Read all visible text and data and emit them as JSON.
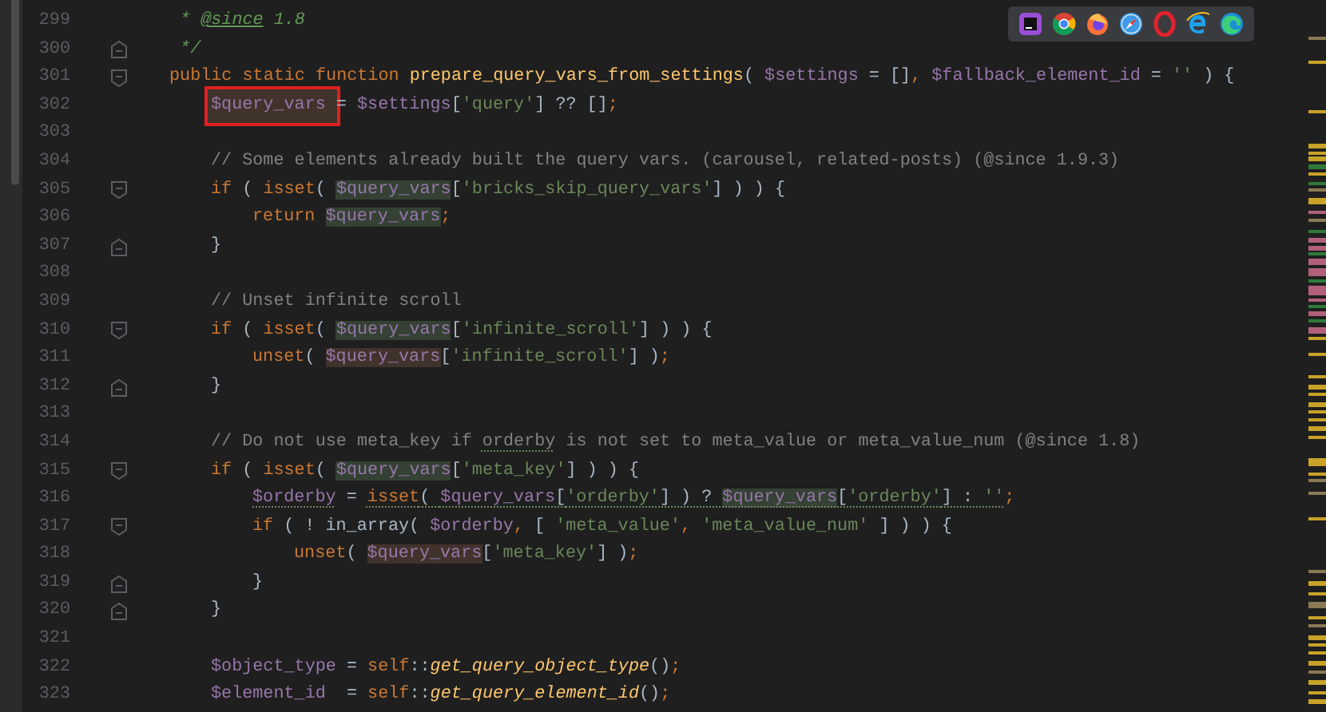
{
  "editor": {
    "lines": [
      {
        "number": "299",
        "tokens": [
          {
            "text": " * ",
            "kind": "doc"
          },
          {
            "text": "@since",
            "kind": "doctag"
          },
          {
            "text": " 1.8",
            "kind": "doc"
          }
        ]
      },
      {
        "number": "300",
        "fold_end": true,
        "tokens": [
          {
            "text": " */",
            "kind": "doc"
          }
        ]
      },
      {
        "number": "301",
        "fold_start": true,
        "tokens": [
          {
            "text": "public static function ",
            "kind": "kw"
          },
          {
            "text": "prepare_query_vars_from_settings",
            "kind": "fn"
          },
          {
            "text": "( ",
            "kind": "p"
          },
          {
            "text": "$settings",
            "kind": "var"
          },
          {
            "text": " = []",
            "kind": "p"
          },
          {
            "text": ", ",
            "kind": "kw"
          },
          {
            "text": "$fallback_element_id",
            "kind": "var"
          },
          {
            "text": " = ",
            "kind": "p"
          },
          {
            "text": "''",
            "kind": "str"
          },
          {
            "text": " ) {",
            "kind": "p"
          }
        ],
        "children": [
          {
            "number": "302",
            "tokens": [
              {
                "text": "$query_vars",
                "kind": "var",
                "write_highlight": true,
                "boxed": true
              },
              {
                "text": " = ",
                "kind": "p"
              },
              {
                "text": "$settings",
                "kind": "var"
              },
              {
                "text": "[",
                "kind": "p"
              },
              {
                "text": "'query'",
                "kind": "str"
              },
              {
                "text": "] ?? []",
                "kind": "p"
              },
              {
                "text": ";",
                "kind": "kw"
              }
            ]
          },
          {
            "number": "303"
          },
          {
            "number": "304",
            "tokens": [
              {
                "text": "// Some elements already built the query vars. (carousel, related-posts) (@since 1.9.3)",
                "kind": "cmt"
              }
            ]
          },
          {
            "number": "305",
            "fold_start": true,
            "tokens": [
              {
                "text": "if",
                "kind": "kw"
              },
              {
                "text": " ( ",
                "kind": "p"
              },
              {
                "text": "isset",
                "kind": "kw"
              },
              {
                "text": "( ",
                "kind": "p"
              },
              {
                "text": "$query_vars",
                "kind": "var",
                "read_highlight": true
              },
              {
                "text": "[",
                "kind": "p"
              },
              {
                "text": "'bricks_skip_query_vars'",
                "kind": "str"
              },
              {
                "text": "] ) ) {",
                "kind": "p"
              }
            ],
            "children": [
              {
                "number": "306",
                "tokens": [
                  {
                    "text": "return ",
                    "kind": "kw"
                  },
                  {
                    "text": "$query_vars",
                    "kind": "var",
                    "read_highlight": true
                  },
                  {
                    "text": ";",
                    "kind": "kw"
                  }
                ]
              }
            ]
          },
          {
            "number": "307",
            "fold_end": true,
            "tokens": [
              {
                "text": "}",
                "kind": "p"
              }
            ]
          },
          {
            "number": "308"
          },
          {
            "number": "309",
            "tokens": [
              {
                "text": "// Unset infinite scroll",
                "kind": "cmt"
              }
            ]
          },
          {
            "number": "310",
            "fold_start": true,
            "tokens": [
              {
                "text": "if",
                "kind": "kw"
              },
              {
                "text": " ( ",
                "kind": "p"
              },
              {
                "text": "isset",
                "kind": "kw"
              },
              {
                "text": "( ",
                "kind": "p"
              },
              {
                "text": "$query_vars",
                "kind": "var",
                "read_highlight": true
              },
              {
                "text": "[",
                "kind": "p"
              },
              {
                "text": "'infinite_scroll'",
                "kind": "str"
              },
              {
                "text": "] ) ) {",
                "kind": "p"
              }
            ],
            "children": [
              {
                "number": "311",
                "tokens": [
                  {
                    "text": "unset",
                    "kind": "kw"
                  },
                  {
                    "text": "( ",
                    "kind": "p"
                  },
                  {
                    "text": "$query_vars",
                    "kind": "var",
                    "write_highlight": true
                  },
                  {
                    "text": "[",
                    "kind": "p"
                  },
                  {
                    "text": "'infinite_scroll'",
                    "kind": "str"
                  },
                  {
                    "text": "] )",
                    "kind": "p"
                  },
                  {
                    "text": ";",
                    "kind": "kw"
                  }
                ]
              }
            ]
          },
          {
            "number": "312",
            "fold_end": true,
            "tokens": [
              {
                "text": "}",
                "kind": "p"
              }
            ]
          },
          {
            "number": "313"
          },
          {
            "number": "314",
            "tokens": [
              {
                "text": "// Do not use meta_key if ",
                "kind": "cmt"
              },
              {
                "text": "orderby",
                "kind": "cmt",
                "underline": true
              },
              {
                "text": " is not set to meta_value or meta_value_num (@since 1.8)",
                "kind": "cmt"
              }
            ]
          },
          {
            "number": "315",
            "fold_start": true,
            "tokens": [
              {
                "text": "if",
                "kind": "kw"
              },
              {
                "text": " ( ",
                "kind": "p"
              },
              {
                "text": "isset",
                "kind": "kw"
              },
              {
                "text": "( ",
                "kind": "p"
              },
              {
                "text": "$query_vars",
                "kind": "var",
                "read_highlight": true
              },
              {
                "text": "[",
                "kind": "p"
              },
              {
                "text": "'meta_key'",
                "kind": "str"
              },
              {
                "text": "] ) ) {",
                "kind": "p"
              }
            ],
            "children": [
              {
                "number": "316",
                "tokens": [
                  {
                    "text": "$orderby",
                    "kind": "var",
                    "underline": true
                  },
                  {
                    "text": " = ",
                    "kind": "p"
                  },
                  {
                    "text": "isset",
                    "kind": "kw",
                    "underline": true
                  },
                  {
                    "text": "( ",
                    "kind": "p",
                    "underline": true
                  },
                  {
                    "text": "$query_vars",
                    "kind": "var",
                    "underline": true
                  },
                  {
                    "text": "[",
                    "kind": "p",
                    "underline": true
                  },
                  {
                    "text": "'orderby'",
                    "kind": "str",
                    "underline": true
                  },
                  {
                    "text": "] ) ? ",
                    "kind": "p",
                    "underline": true
                  },
                  {
                    "text": "$query_vars",
                    "kind": "var",
                    "read_highlight": true,
                    "underline": true
                  },
                  {
                    "text": "[",
                    "kind": "p",
                    "underline": true
                  },
                  {
                    "text": "'orderby'",
                    "kind": "str",
                    "underline": true
                  },
                  {
                    "text": "] : ",
                    "kind": "p",
                    "underline": true
                  },
                  {
                    "text": "''",
                    "kind": "str",
                    "underline": true
                  },
                  {
                    "text": ";",
                    "kind": "kw"
                  }
                ]
              },
              {
                "number": "317",
                "fold_start": true,
                "tokens": [
                  {
                    "text": "if",
                    "kind": "kw"
                  },
                  {
                    "text": " ( ! in_array( ",
                    "kind": "p"
                  },
                  {
                    "text": "$orderby",
                    "kind": "var"
                  },
                  {
                    "text": ", ",
                    "kind": "kw"
                  },
                  {
                    "text": "[ ",
                    "kind": "p"
                  },
                  {
                    "text": "'meta_value'",
                    "kind": "str"
                  },
                  {
                    "text": ", ",
                    "kind": "kw"
                  },
                  {
                    "text": "'meta_value_num'",
                    "kind": "str"
                  },
                  {
                    "text": " ] ) ) {",
                    "kind": "p"
                  }
                ],
                "children": [
                  {
                    "number": "318",
                    "tokens": [
                      {
                        "text": "unset",
                        "kind": "kw"
                      },
                      {
                        "text": "( ",
                        "kind": "p"
                      },
                      {
                        "text": "$query_vars",
                        "kind": "var",
                        "write_highlight": true
                      },
                      {
                        "text": "[",
                        "kind": "p"
                      },
                      {
                        "text": "'meta_key'",
                        "kind": "str"
                      },
                      {
                        "text": "] )",
                        "kind": "p"
                      },
                      {
                        "text": ";",
                        "kind": "kw"
                      }
                    ]
                  }
                ]
              },
              {
                "number": "319",
                "fold_end": true,
                "tokens": [
                  {
                    "text": "}",
                    "kind": "p"
                  }
                ]
              }
            ]
          },
          {
            "number": "320",
            "fold_end": true,
            "tokens": [
              {
                "text": "}",
                "kind": "p"
              }
            ]
          },
          {
            "number": "321"
          },
          {
            "number": "322",
            "tokens": [
              {
                "text": "$object_type",
                "kind": "var"
              },
              {
                "text": " = ",
                "kind": "p"
              },
              {
                "text": "self",
                "kind": "kw"
              },
              {
                "text": "::",
                "kind": "p"
              },
              {
                "text": "get_query_object_type",
                "kind": "call"
              },
              {
                "text": "()",
                "kind": "p"
              },
              {
                "text": ";",
                "kind": "kw"
              }
            ]
          },
          {
            "number": "323",
            "tokens": [
              {
                "text": "$element_id",
                "kind": "var"
              },
              {
                "text": "  = ",
                "kind": "p"
              },
              {
                "text": "self",
                "kind": "kw"
              },
              {
                "text": "::",
                "kind": "p"
              },
              {
                "text": "get_query_element_id",
                "kind": "call"
              },
              {
                "text": "()",
                "kind": "p"
              },
              {
                "text": ";",
                "kind": "kw"
              }
            ]
          }
        ]
      }
    ]
  }
}
